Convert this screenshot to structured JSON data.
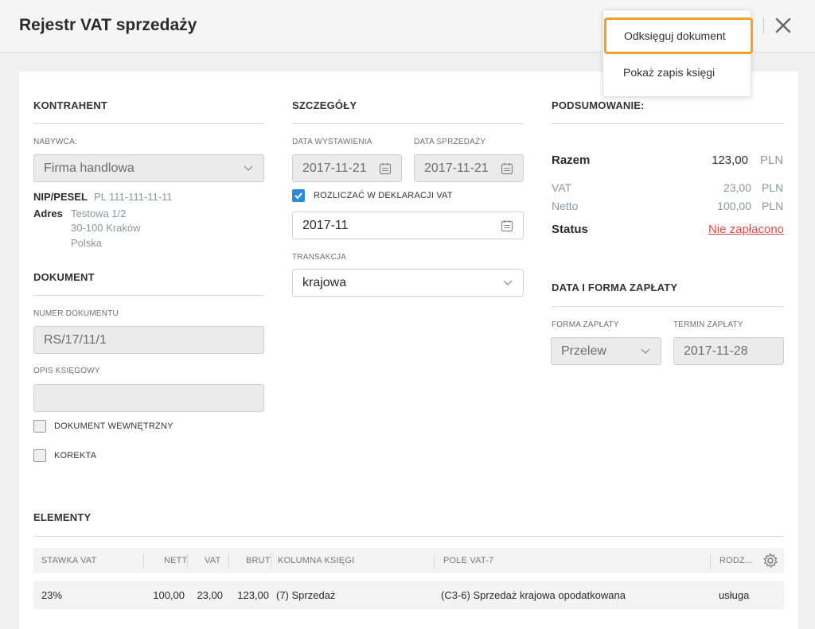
{
  "header": {
    "title": "Rejestr VAT sprzedaży"
  },
  "menu": {
    "items": [
      {
        "label": "Odksięguj dokument"
      },
      {
        "label": "Pokaż zapis księgi"
      }
    ]
  },
  "kontrahent": {
    "title": "KONTRAHENT",
    "buyer_label": "NABYWCA:",
    "buyer_value": "Firma handlowa",
    "nip_label": "NIP/PESEL",
    "nip_value": "PL 111-111-11-11",
    "address_label": "Adres",
    "address_lines": [
      "Testowa 1/2",
      "30-100 Kraków",
      "Polska"
    ]
  },
  "dokument": {
    "title": "DOKUMENT",
    "number_label": "NUMER DOKUMENTU",
    "number_value": "RS/17/11/1",
    "desc_label": "OPIS KSIĘGOWY",
    "desc_value": "",
    "internal_label": "DOKUMENT WEWNĘTRZNY",
    "correction_label": "KOREKTA"
  },
  "szczegoly": {
    "title": "SZCZEGÓŁY",
    "issue_date_label": "DATA WYSTAWIENIA",
    "issue_date": "2017-11-21",
    "sale_date_label": "DATA SPRZEDAŻY",
    "sale_date": "2017-11-21",
    "vat_settle_label": "ROZLICZAĆ W DEKLARACJI VAT",
    "vat_period": "2017-11",
    "transaction_label": "TRANSAKCJA",
    "transaction_value": "krajowa"
  },
  "summary": {
    "title": "PODSUMOWANIE:",
    "total_label": "Razem",
    "total_value": "123,00",
    "total_currency": "PLN",
    "vat_label": "VAT",
    "vat_value": "23,00",
    "vat_currency": "PLN",
    "net_label": "Netto",
    "net_value": "100,00",
    "net_currency": "PLN",
    "status_label": "Status",
    "status_value": "Nie zapłacono"
  },
  "payment": {
    "title": "DATA I FORMA ZAPŁATY",
    "form_label": "FORMA ZAPŁATY",
    "form_value": "Przelew",
    "due_label": "TERMIN ZAPŁATY",
    "due_value": "2017-11-28"
  },
  "elements": {
    "title": "ELEMENTY",
    "columns": [
      "STAWKA VAT",
      "NETT",
      "VAT",
      "BRUT",
      "KOLUMNA KSIĘGI",
      "POLE VAT-7",
      "RODZ..."
    ],
    "rows": [
      {
        "rate": "23%",
        "net": "100,00",
        "vat": "23,00",
        "gross": "123,00",
        "column": "(7) Sprzedaż",
        "field": "(C3-6) Sprzedaż krajowa opodatkowana",
        "type": "usługa"
      }
    ]
  },
  "colors": {
    "accent_blue": "#2d8ad8",
    "status_red": "#e04848",
    "highlight_orange": "#f0a02c"
  },
  "icons": {
    "close": "close-icon",
    "calendar": "calendar-icon",
    "chevron": "chevron-down-icon",
    "check": "check-icon",
    "settings": "gear-icon"
  }
}
